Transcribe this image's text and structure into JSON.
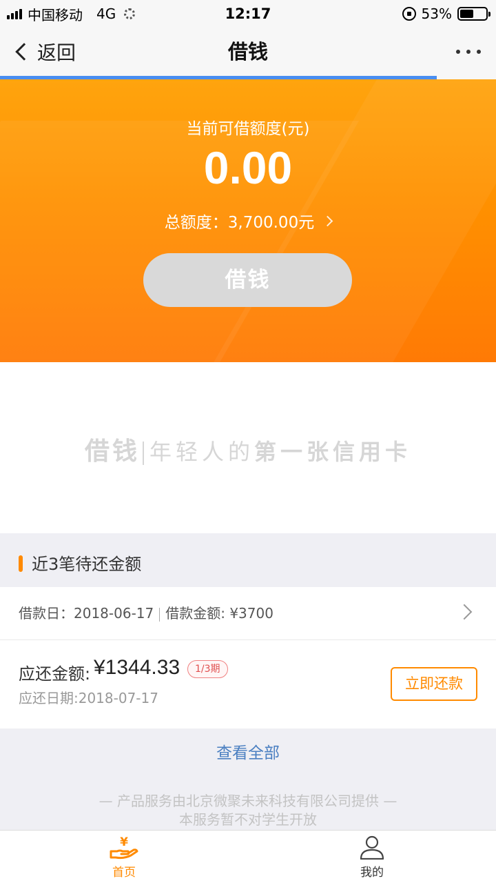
{
  "status_bar": {
    "carrier": "中国移动",
    "network": "4G",
    "time": "12:17",
    "battery": "53%",
    "battery_level": 0.53
  },
  "nav": {
    "back_label": "返回",
    "title": "借钱"
  },
  "hero": {
    "limit_label": "当前可借额度(元)",
    "limit_value": "0.00",
    "total_label": "总额度：3,700.00元",
    "borrow_button": "借钱"
  },
  "slogan": {
    "brand": "借钱",
    "part1": "年轻人的",
    "part2": "第一张信用卡"
  },
  "pending": {
    "section_title": "近3笔待还金额",
    "loan_date_text": "借款日：2018-06-17",
    "loan_amount_text": "借款金额: ¥3700",
    "due_label": "应还金额:",
    "due_amount": "¥1344.33",
    "period": "1/3期",
    "due_date_text": "应还日期:2018-07-17",
    "repay_button": "立即还款"
  },
  "view_all": "查看全部",
  "footer": {
    "line1": "— 产品服务由北京微聚未来科技有限公司提供 —",
    "line2": "本服务暂不对学生开放"
  },
  "tabs": [
    {
      "label": "首页",
      "icon": "home-yen-icon",
      "active": true
    },
    {
      "label": "我的",
      "icon": "person-icon",
      "active": false
    }
  ],
  "colors": {
    "accent": "#ff8a00",
    "link": "#4a7fc1",
    "progress": "#4a8ef0"
  }
}
